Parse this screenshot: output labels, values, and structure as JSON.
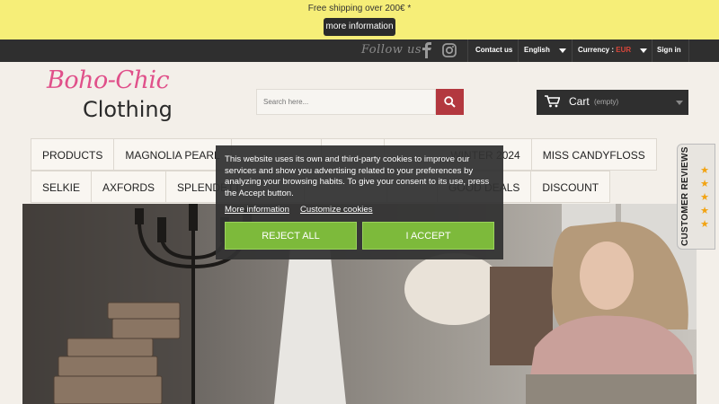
{
  "promo": {
    "shipping_text": "Free shipping over 200€ *",
    "more_info_label": "more information"
  },
  "topbar": {
    "follow_label": "Follow us",
    "contact_label": "Contact us",
    "language_label": "English",
    "currency_label": "Currency :",
    "currency_value": "EUR",
    "signin_label": "Sign in",
    "social_icons": [
      "facebook-icon",
      "instagram-icon"
    ]
  },
  "header": {
    "logo_line1": "Boho-Chic",
    "logo_line2": "Clothing",
    "search_placeholder": "Search here...",
    "cart_label": "Cart",
    "cart_status": "(empty)"
  },
  "menu": {
    "row1": [
      "PRODUCTS",
      "MAGNOLIA PEARL",
      "",
      "",
      "WINTER 2024",
      "MISS CANDYFLOSS"
    ],
    "row2": [
      "SELKIE",
      "AXFORDS",
      "SPLENDETTE",
      "",
      "",
      "",
      "GOOD DEALS",
      "DISCOUNT"
    ]
  },
  "reviews_tab": {
    "label": "CUSTOMER REVIEWS",
    "stars": 5
  },
  "cookie": {
    "message": "This website uses its own and third-party cookies to improve our services and show you advertising related to your preferences by analyzing your browsing habits. To give your consent to its use, press the Accept button.",
    "more_info_link": "More information",
    "customize_link": "Customize cookies",
    "reject_label": "REJECT ALL",
    "accept_label": "I ACCEPT"
  },
  "colors": {
    "promo_bg": "#f6ee78",
    "accent_red": "#b3383f",
    "logo_pink": "#e0508a",
    "accept_green": "#7dba3b",
    "dark_bar": "#2f2f2f"
  }
}
